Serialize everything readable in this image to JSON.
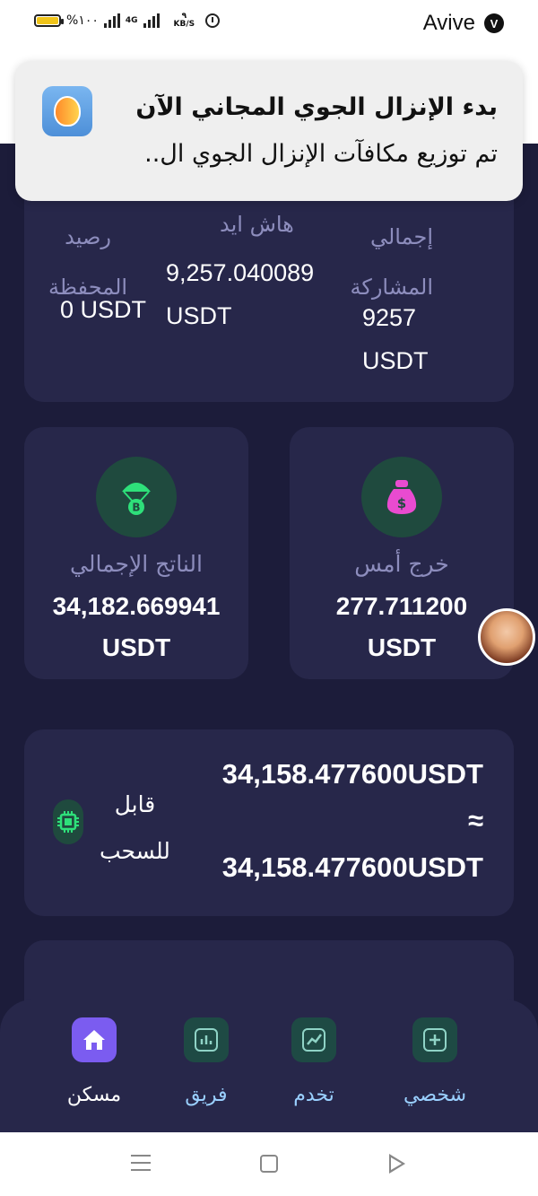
{
  "status_bar": {
    "battery_text": "%١٠٠",
    "network_type": "4G",
    "speed_value": "٩",
    "speed_unit": "KB/S",
    "carrier": "Avive",
    "carrier_badge": "V"
  },
  "notification": {
    "title": "بدء الإنزال الجوي المجاني الآن",
    "body": "تم توزيع مكافآت الإنزال الجوي ال.."
  },
  "stats": {
    "total_label_1": "إجمالي",
    "total_label_2": "المشاركة",
    "total_value": "9257",
    "total_unit": "USDT",
    "hash_label": "هاش ايد",
    "hash_value": "9,257.040089",
    "hash_unit": "USDT",
    "wallet_label_1": "رصيد",
    "wallet_label_2": "المحفظة",
    "wallet_value": "0 USDT"
  },
  "yesterday": {
    "label": "خرج أمس",
    "value": "277.711200",
    "unit": "USDT",
    "icon": "money-bag-icon",
    "icon_color": "#e94bd0"
  },
  "gross": {
    "label": "الناتج الإجمالي",
    "value": "34,182.669941",
    "unit": "USDT",
    "icon": "bitcoin-parachute-icon",
    "icon_color": "#2ee07a"
  },
  "withdrawable": {
    "label_1": "قابل",
    "label_2": "للسحب",
    "value": "34,158.477600USDT",
    "approx": "≈",
    "value_2": "34,158.477600USDT"
  },
  "bottom_nav": {
    "items": [
      {
        "label": "شخصي",
        "icon": "plus-square-icon"
      },
      {
        "label": "تخدم",
        "icon": "chart-line-icon"
      },
      {
        "label": "فريق",
        "icon": "bar-chart-icon"
      },
      {
        "label": "مسكن",
        "icon": "home-icon"
      }
    ]
  },
  "colors": {
    "background": "#1c1c3a",
    "card": "#27274a",
    "label": "#8d8dbd",
    "accent": "#7b5cf0",
    "icon_circle": "#1f4a3e"
  }
}
